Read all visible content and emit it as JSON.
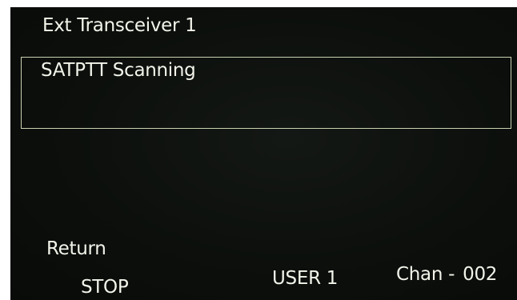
{
  "header": {
    "title": "Ext Transceiver 1"
  },
  "status": {
    "text": "SATPTT Scanning"
  },
  "softkeys": {
    "return_label": "Return",
    "stop_label": "STOP"
  },
  "footer": {
    "profile": "USER 1",
    "channel_label": "Chan -",
    "channel_number": "002"
  },
  "colors": {
    "background": "#0b0e0b",
    "text": "#f2f4ea",
    "box_border": "#c9d2b0"
  }
}
